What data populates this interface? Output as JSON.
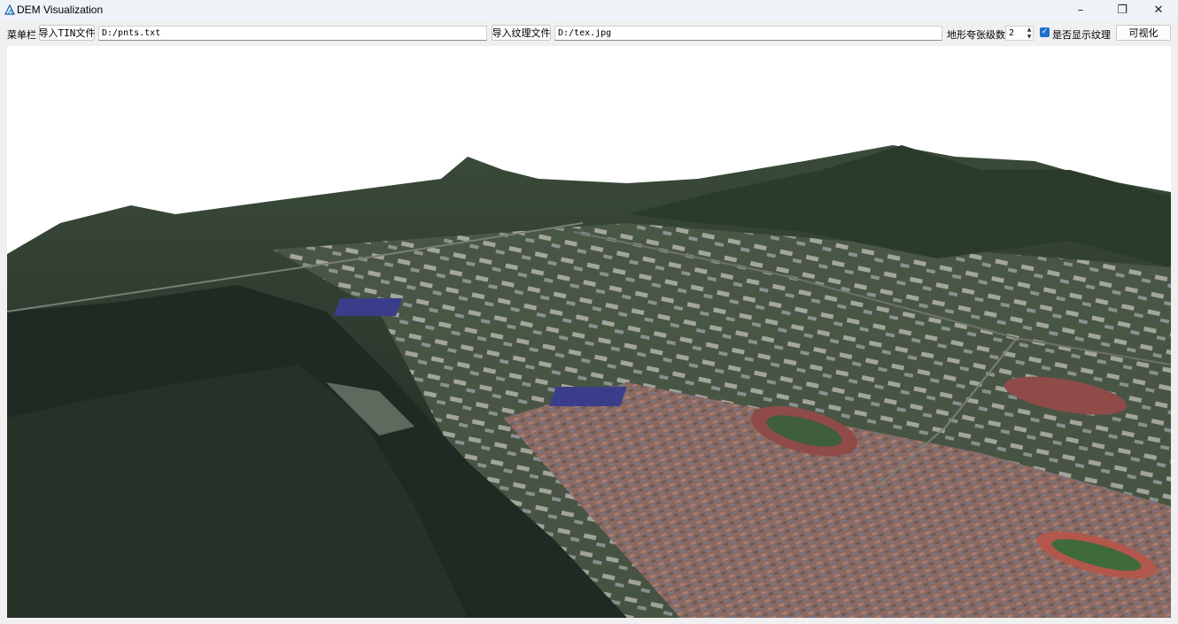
{
  "window": {
    "title": "DEM Visualization",
    "minimize_glyph": "–",
    "restore_glyph": "❐",
    "close_glyph": "✕"
  },
  "toolbar": {
    "menu_label": "菜单栏",
    "import_tin_label": "导入TIN文件",
    "tin_path": "D:/pnts.txt",
    "import_texture_label": "导入纹理文件",
    "texture_path": "D:/tex.jpg",
    "exaggeration_label": "地形夸张级数",
    "exaggeration_value": "2",
    "show_texture_label": "是否显示纹理",
    "show_texture_checked": true,
    "visualize_label": "可视化"
  },
  "viewport": {
    "content": "3D textured terrain rendering"
  },
  "colors": {
    "accent": "#1f6fcf",
    "titlebar": "#eef3f8"
  }
}
